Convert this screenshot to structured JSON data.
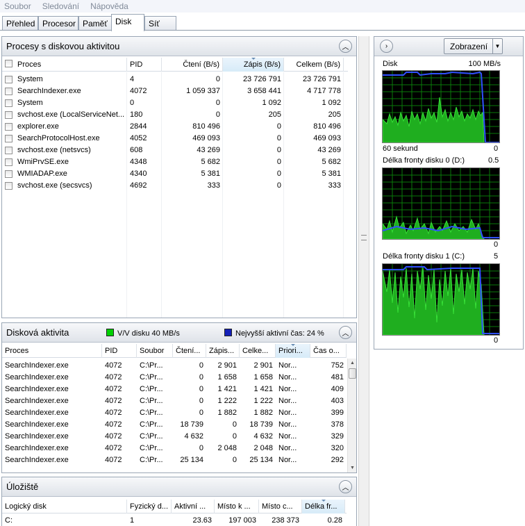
{
  "menu": [
    "Soubor",
    "Sledování",
    "Nápověda"
  ],
  "tabs": [
    "Přehled",
    "Procesor",
    "Paměť",
    "Disk",
    "Síť"
  ],
  "active_tab": "Disk",
  "processes_panel": {
    "title": "Procesy s diskovou aktivitou",
    "columns": [
      "Proces",
      "PID",
      "Čtení (B/s)",
      "Zápis (B/s)",
      "Celkem (B/s)"
    ],
    "sorted_column": "Zápis (B/s)",
    "rows": [
      [
        "System",
        "4",
        "0",
        "23 726 791",
        "23 726 791"
      ],
      [
        "SearchIndexer.exe",
        "4072",
        "1 059 337",
        "3 658 441",
        "4 717 778"
      ],
      [
        "System",
        "0",
        "0",
        "1 092",
        "1 092"
      ],
      [
        "svchost.exe (LocalServiceNet...",
        "180",
        "0",
        "205",
        "205"
      ],
      [
        "explorer.exe",
        "2844",
        "810 496",
        "0",
        "810 496"
      ],
      [
        "SearchProtocolHost.exe",
        "4052",
        "469 093",
        "0",
        "469 093"
      ],
      [
        "svchost.exe (netsvcs)",
        "608",
        "43 269",
        "0",
        "43 269"
      ],
      [
        "WmiPrvSE.exe",
        "4348",
        "5 682",
        "0",
        "5 682"
      ],
      [
        "WMIADAP.exe",
        "4340",
        "5 381",
        "0",
        "5 381"
      ],
      [
        "svchost.exe (secsvcs)",
        "4692",
        "333",
        "0",
        "333"
      ]
    ]
  },
  "disk_activity_panel": {
    "title": "Disková aktivita",
    "legend_io": "V/V disku 40 MB/s",
    "legend_active": "Nejvyšší aktivní čas: 24 %",
    "legend_io_color": "#00d000",
    "legend_active_color": "#1420b8",
    "columns": [
      "Proces",
      "PID",
      "Soubor",
      "Čtení...",
      "Zápis...",
      "Celke...",
      "Priori...",
      "Čas o..."
    ],
    "sorted_column": "Priori...",
    "rows": [
      [
        "SearchIndexer.exe",
        "4072",
        "C:\\Pr...",
        "0",
        "2 901",
        "2 901",
        "Nor...",
        "752"
      ],
      [
        "SearchIndexer.exe",
        "4072",
        "C:\\Pr...",
        "0",
        "1 658",
        "1 658",
        "Nor...",
        "481"
      ],
      [
        "SearchIndexer.exe",
        "4072",
        "C:\\Pr...",
        "0",
        "1 421",
        "1 421",
        "Nor...",
        "409"
      ],
      [
        "SearchIndexer.exe",
        "4072",
        "C:\\Pr...",
        "0",
        "1 222",
        "1 222",
        "Nor...",
        "403"
      ],
      [
        "SearchIndexer.exe",
        "4072",
        "C:\\Pr...",
        "0",
        "1 882",
        "1 882",
        "Nor...",
        "399"
      ],
      [
        "SearchIndexer.exe",
        "4072",
        "C:\\Pr...",
        "18 739",
        "0",
        "18 739",
        "Nor...",
        "378"
      ],
      [
        "SearchIndexer.exe",
        "4072",
        "C:\\Pr...",
        "4 632",
        "0",
        "4 632",
        "Nor...",
        "329"
      ],
      [
        "SearchIndexer.exe",
        "4072",
        "C:\\Pr...",
        "0",
        "2 048",
        "2 048",
        "Nor...",
        "320"
      ],
      [
        "SearchIndexer.exe",
        "4072",
        "C:\\Pr...",
        "25 134",
        "0",
        "25 134",
        "Nor...",
        "292"
      ]
    ]
  },
  "storage_panel": {
    "title": "Úložiště",
    "columns": [
      "Logický disk",
      "Fyzický d...",
      "Aktivní ...",
      "Místo k ...",
      "Místo c...",
      "Délka fr..."
    ],
    "sorted_column": "Délka fr...",
    "rows": [
      [
        "C:",
        "1",
        "23.63",
        "197 003",
        "238 373",
        "0.28"
      ]
    ]
  },
  "graph_panel": {
    "view_button": "Zobrazení",
    "graphs": [
      {
        "title": "Disk",
        "max_label": "100 MB/s",
        "time_label": "60 sekund",
        "min_label": "0"
      },
      {
        "title": "Délka fronty disku 0 (D:)",
        "max_label": "0.5",
        "min_label": "0"
      },
      {
        "title": "Délka fronty disku 1 (C:)",
        "max_label": "5",
        "min_label": "0"
      }
    ]
  }
}
